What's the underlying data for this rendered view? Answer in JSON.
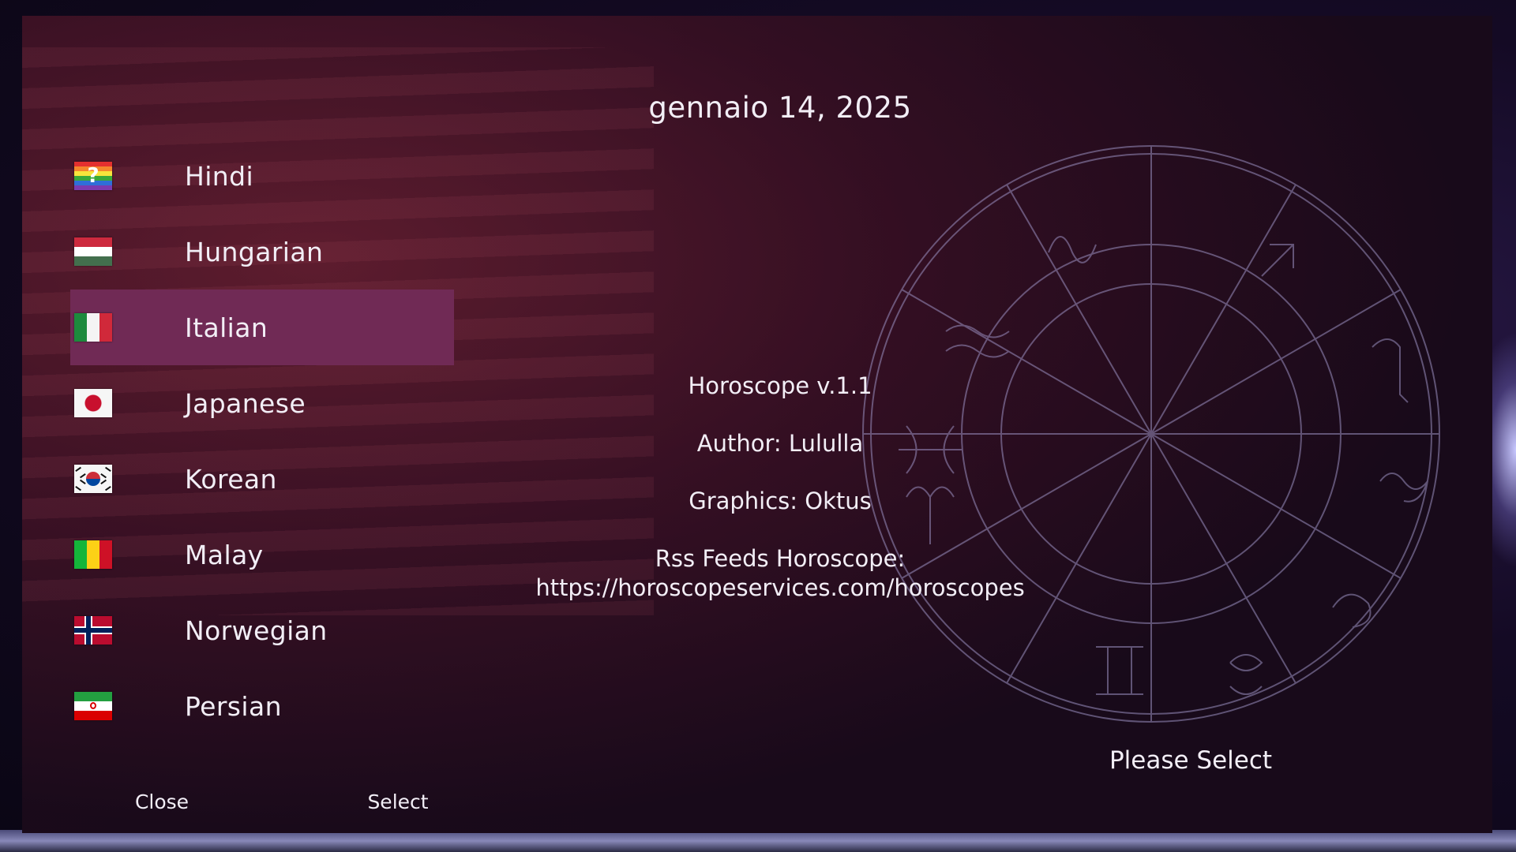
{
  "date": "gennaio 14, 2025",
  "languages": [
    {
      "label": "Hindi",
      "flag": "rainbow-question-flag-icon"
    },
    {
      "label": "Hungarian",
      "flag": "hungary-flag-icon"
    },
    {
      "label": "Italian",
      "flag": "italy-flag-icon",
      "selected": true
    },
    {
      "label": "Japanese",
      "flag": "japan-flag-icon"
    },
    {
      "label": "Korean",
      "flag": "korea-flag-icon"
    },
    {
      "label": "Malay",
      "flag": "malay-flag-icon"
    },
    {
      "label": "Norwegian",
      "flag": "norway-flag-icon"
    },
    {
      "label": "Persian",
      "flag": "iran-flag-icon"
    }
  ],
  "info": {
    "version": "Horoscope v.1.1",
    "author": "Author: Lululla",
    "graphics": "Graphics: Oktus",
    "feeds_label": "Rss Feeds Horoscope:",
    "feeds_url": "https://horoscopeservices.com/horoscopes"
  },
  "status": "Please Select",
  "buttons": {
    "close": {
      "label": "Close",
      "color": "#e01818"
    },
    "select": {
      "label": "Select",
      "color": "#1ed81e"
    }
  },
  "colors": {
    "selected_bg": "#702a55"
  }
}
